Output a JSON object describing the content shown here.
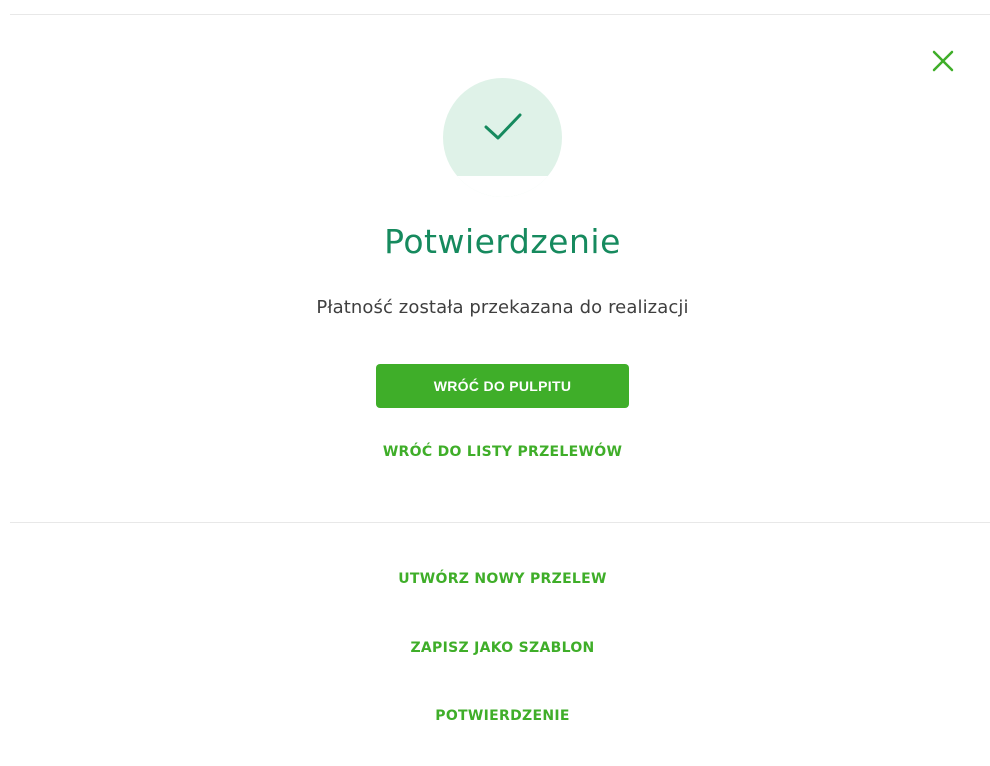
{
  "dialog": {
    "title": "Potwierdzenie",
    "message": "Płatność została przekazana do realizacji",
    "close_icon": "close-icon",
    "status_icon": "check-icon"
  },
  "actions": {
    "back_to_dashboard": "WRÓĆ DO PULPITU",
    "back_to_transfers_list": "WRÓĆ DO LISTY PRZELEWÓW"
  },
  "secondary_actions": {
    "new_transfer": "UTWÓRZ NOWY PRZELEW",
    "save_template": "ZAPISZ JAKO SZABLON",
    "confirmation": "POTWIERDZENIE"
  },
  "colors": {
    "accent_green": "#3fae29",
    "title_green": "#168a5e",
    "success_circle": "#dff2e8"
  }
}
